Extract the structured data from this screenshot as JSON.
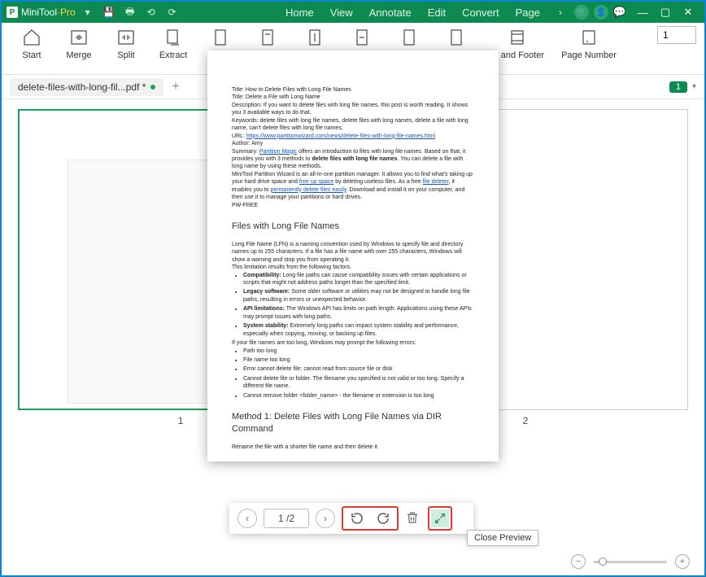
{
  "app": {
    "name": "MiniTool",
    "suffix": "·Pro"
  },
  "menus": [
    "Home",
    "View",
    "Annotate",
    "Edit",
    "Convert",
    "Page"
  ],
  "ribbon": {
    "start": "Start",
    "merge": "Merge",
    "split": "Split",
    "extract": "Extract",
    "header_footer": "er and Footer",
    "page_number": "Page Number",
    "page_input": "1"
  },
  "tab": {
    "filename": "delete-files-with-long-fil...pdf *",
    "badge": "1"
  },
  "thumbs": {
    "one": "1",
    "two": "2"
  },
  "controls": {
    "page_display": "1 /2",
    "tooltip": "Close Preview"
  },
  "doc": {
    "title_line": "Title: How to Delete Files with Long File Names",
    "title2": "Title: Delete a File with Long Name",
    "desc": "Description: If you want to delete files with long file names, this post is worth reading. It shows you 3 available ways to do that.",
    "keywords": "Keywords: delete files with long file names, delete files with long names, delete a file with long name, can't delete files with long file names,",
    "url_label": "URL: ",
    "url": "https://www.partitionwizard.com/news/delete-files-with-long-file-names.html",
    "author": "Author: Amy",
    "summary_pre": "Summary: ",
    "summary_link": "Partition Magic",
    "summary_post": " offers an introduction to files with long file names. Based on that, it provides you with 3 methods to ",
    "summary_bold": "delete files with long file names",
    "summary_end": ". You can delete a file with long name by using these methods.",
    "pw1": "MiniTool Partition Wizard is an all-in-one partition manager. It allows you to find what's taking up your hard drive space and ",
    "pw_link1": "free up space",
    "pw2": " by deleting useless files. As a free ",
    "pw_link2": "file deleter",
    "pw3": ", it enables you to ",
    "pw_link3": "permanently delete files easily",
    "pw4": ". Download and install it on your computer, and then use it to manage your partitions or hard drives.",
    "pwfree": "PW-FREE",
    "h_lfn": "Files with Long File Names",
    "lfn_p1": "Long File Name (LFN) is a naming convention used by Windows to specify file and directory names up to 255 characters. If a file has a file name with over 255 characters, Windows will show a warning and stop you from operating it.",
    "lfn_p2": "This limitation results from the following factors.",
    "b_compat_b": "Compatibility:",
    "b_compat": " Long file paths can cause compatibility issues with certain applications or scripts that might not address paths longer than the specified limit.",
    "b_legacy_b": "Legacy software:",
    "b_legacy": " Some older software or utilities may not be designed to handle long file paths, resulting in errors or unexpected behavior.",
    "b_api_b": "API limitations:",
    "b_api": " The Windows API has limits on path length. Applications using these APIs may prompt issues with long paths.",
    "b_stab_b": "System stability:",
    "b_stab": " Extremely long paths can impact system stability and performance, especially when copying, moving, or backing up files.",
    "err_intro": "If your file names are too long, Windows may prompt the following errors:",
    "e1": "Path too long",
    "e2": "File name too long",
    "e3": "Error cannot delete file: cannot read from source file or disk",
    "e4": "Cannot delete file or folder. The filename you specified is not valid or too long. Specify a different file name.",
    "e5": "Cannot remove folder <folder_name> - the filename or extension is too long",
    "h_method1": "Method 1: Delete Files with Long File Names via DIR Command",
    "m1_p": "Rename the file with a shorter file name and then delete it."
  }
}
